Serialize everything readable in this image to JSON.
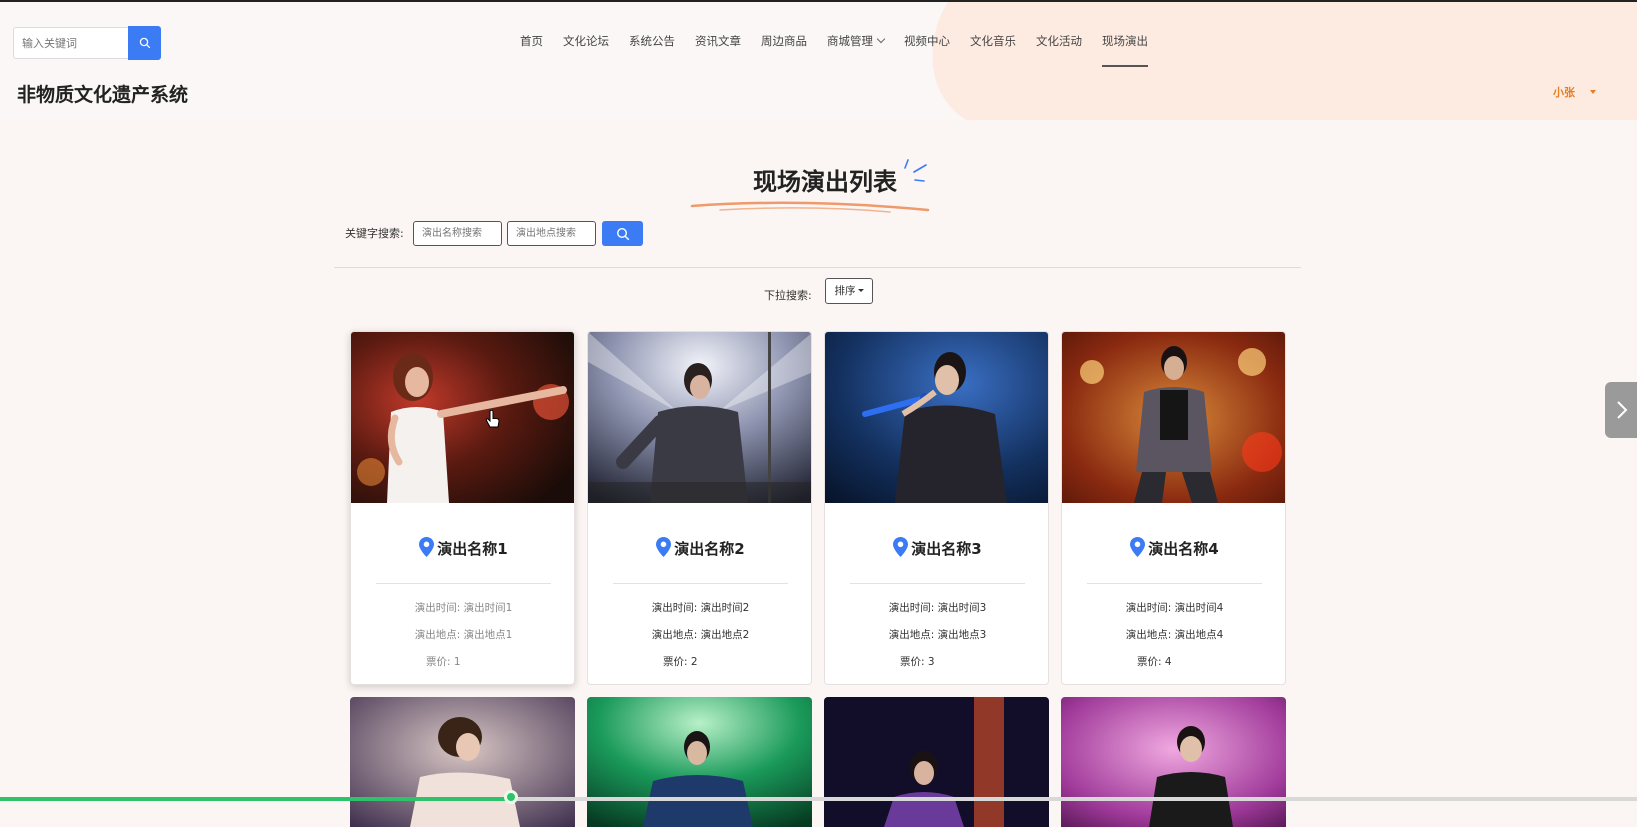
{
  "header": {
    "search_placeholder": "输入关键词",
    "site_title": "非物质文化遗产系统",
    "user_name": "小张",
    "nav": [
      {
        "label": "首页"
      },
      {
        "label": "文化论坛"
      },
      {
        "label": "系统公告"
      },
      {
        "label": "资讯文章"
      },
      {
        "label": "周边商品"
      },
      {
        "label": "商城管理"
      },
      {
        "label": "视频中心"
      },
      {
        "label": "文化音乐"
      },
      {
        "label": "文化活动"
      },
      {
        "label": "现场演出"
      }
    ]
  },
  "main": {
    "title": "现场演出列表",
    "keyword_label": "关键字搜索:",
    "name_placeholder": "演出名称搜索",
    "place_placeholder": "演出地点搜索",
    "dropdown_label": "下拉搜索:",
    "sort_label": "排序",
    "cards": [
      {
        "name": "演出名称1",
        "time": "演出时间: 演出时间1",
        "place": "演出地点: 演出地点1",
        "price": "票价: 1"
      },
      {
        "name": "演出名称2",
        "time": "演出时间: 演出时间2",
        "place": "演出地点: 演出地点2",
        "price": "票价: 2"
      },
      {
        "name": "演出名称3",
        "time": "演出时间: 演出时间3",
        "place": "演出地点: 演出地点3",
        "price": "票价: 3"
      },
      {
        "name": "演出名称4",
        "time": "演出时间: 演出时间4",
        "place": "演出地点: 演出地点4",
        "price": "票价: 4"
      }
    ]
  },
  "colors": {
    "accent": "#3b7bf4",
    "user": "#e67e22",
    "progress": "#2ec26a"
  },
  "progress": {
    "fraction": 0.313
  }
}
